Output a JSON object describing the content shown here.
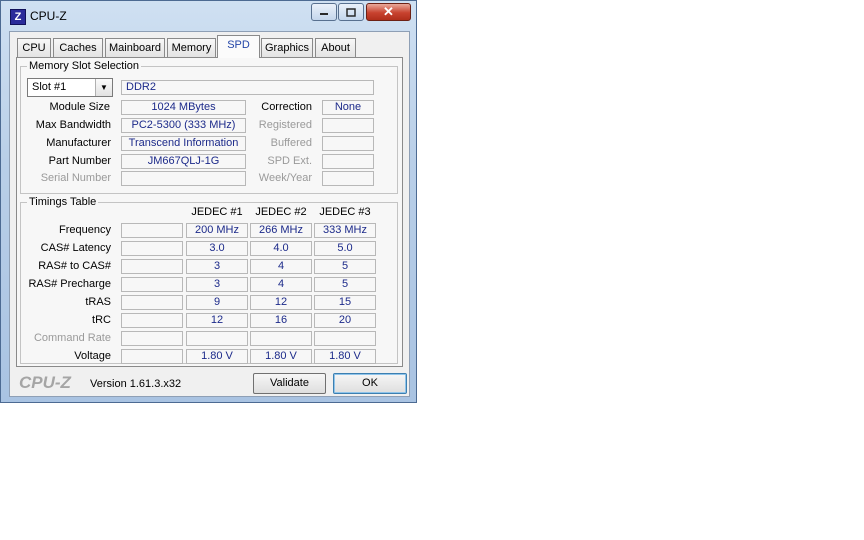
{
  "window": {
    "title": "CPU-Z",
    "icon_letter": "Z",
    "close_glyph": "✕"
  },
  "tabs": [
    "CPU",
    "Caches",
    "Mainboard",
    "Memory",
    "SPD",
    "Graphics",
    "About"
  ],
  "active_tab": "SPD",
  "memory_slot_selection": {
    "title": "Memory Slot Selection",
    "slot_value": "Slot #1",
    "type": "DDR2",
    "labels": {
      "module_size": "Module Size",
      "max_bandwidth": "Max Bandwidth",
      "manufacturer": "Manufacturer",
      "part_number": "Part Number",
      "serial_number": "Serial Number",
      "correction": "Correction",
      "registered": "Registered",
      "buffered": "Buffered",
      "spd_ext": "SPD Ext.",
      "week_year": "Week/Year"
    },
    "values": {
      "module_size": "1024 MBytes",
      "max_bandwidth": "PC2-5300 (333 MHz)",
      "manufacturer": "Transcend Information",
      "part_number": "JM667QLJ-1G",
      "serial_number": "",
      "correction": "None",
      "registered": "",
      "buffered": "",
      "spd_ext": "",
      "week_year": ""
    }
  },
  "timings_table": {
    "title": "Timings Table",
    "columns": [
      "JEDEC #1",
      "JEDEC #2",
      "JEDEC #3"
    ],
    "rows": [
      {
        "label": "Frequency",
        "values": [
          "200 MHz",
          "266 MHz",
          "333 MHz"
        ]
      },
      {
        "label": "CAS# Latency",
        "values": [
          "3.0",
          "4.0",
          "5.0"
        ]
      },
      {
        "label": "RAS# to CAS#",
        "values": [
          "3",
          "4",
          "5"
        ]
      },
      {
        "label": "RAS# Precharge",
        "values": [
          "3",
          "4",
          "5"
        ]
      },
      {
        "label": "tRAS",
        "values": [
          "9",
          "12",
          "15"
        ]
      },
      {
        "label": "tRC",
        "values": [
          "12",
          "16",
          "20"
        ]
      },
      {
        "label": "Command Rate",
        "values": [
          "",
          "",
          ""
        ]
      },
      {
        "label": "Voltage",
        "values": [
          "1.80 V",
          "1.80 V",
          "1.80 V"
        ]
      }
    ]
  },
  "footer": {
    "logo": "CPU-Z",
    "version": "Version 1.61.3.x32",
    "validate_label": "Validate",
    "ok_label": "OK"
  }
}
